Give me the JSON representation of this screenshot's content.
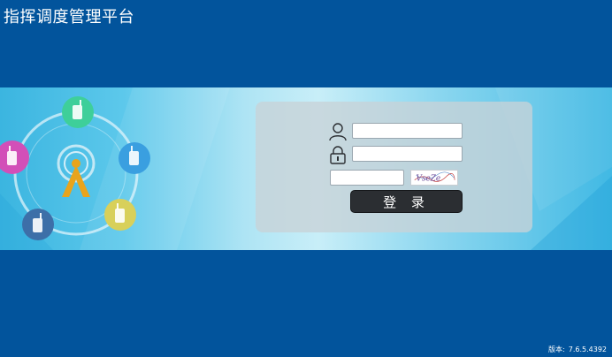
{
  "app": {
    "title": "指挥调度管理平台"
  },
  "login": {
    "username_value": "",
    "password_value": "",
    "captcha_value": "",
    "captcha_text": "VseZe",
    "submit_label": "登 录"
  },
  "footer": {
    "version_label": "版本:",
    "version_value": "7.6.5.4392"
  },
  "colors": {
    "page_background": "#02549c",
    "banner_light": "#c8eef8",
    "banner_dark": "#3bb5e0",
    "button_background": "#2b2e32",
    "device_green": "#3ecf9a",
    "device_magenta": "#d24fb8",
    "device_blue": "#3a9fe0",
    "device_yellow": "#d8d05a",
    "device_navy": "#3d6fa8",
    "tower_gold": "#e8a41c"
  },
  "icons": {
    "user": "user-icon",
    "lock": "lock-icon",
    "tower": "signal-tower-icon",
    "device": "walkie-talkie-icon"
  }
}
